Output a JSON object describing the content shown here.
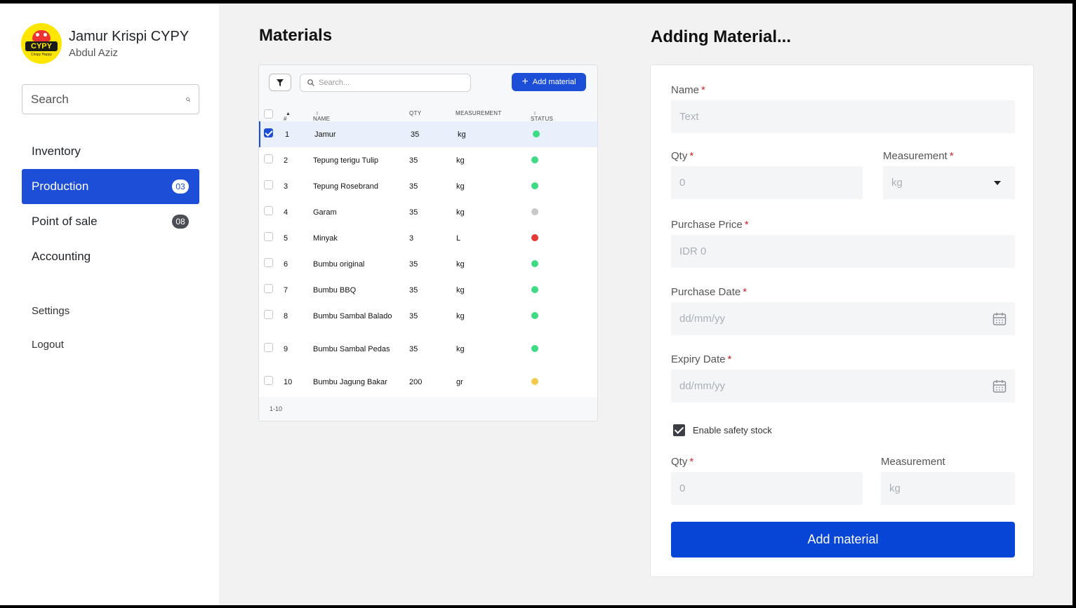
{
  "brand": {
    "logo_word": "CYPY",
    "logo_tagline": "Crispy Happy",
    "name": "Jamur Krispi CYPY",
    "user": "Abdul Aziz"
  },
  "sidebar": {
    "search_placeholder": "Search",
    "items": [
      {
        "label": "Inventory",
        "badge": ""
      },
      {
        "label": "Production",
        "badge": "03"
      },
      {
        "label": "Point of sale",
        "badge": "08"
      },
      {
        "label": "Accounting",
        "badge": ""
      }
    ],
    "settings": "Settings",
    "logout": "Logout"
  },
  "materials": {
    "title": "Materials",
    "search_placeholder": "Search...",
    "add_button": "Add material",
    "columns": {
      "num": "#",
      "name": "NAME",
      "qty": "QTY",
      "measurement": "MEASUREMENT",
      "status": "STATUS"
    },
    "rows": [
      {
        "num": "1",
        "name": "Jamur",
        "qty": "35",
        "measurement": "kg",
        "status_color": "#3ddc84",
        "checked": true
      },
      {
        "num": "2",
        "name": "Tepung terigu Tulip",
        "qty": "35",
        "measurement": "kg",
        "status_color": "#3ddc84",
        "checked": false
      },
      {
        "num": "3",
        "name": "Tepung Rosebrand",
        "qty": "35",
        "measurement": "kg",
        "status_color": "#3ddc84",
        "checked": false
      },
      {
        "num": "4",
        "name": "Garam",
        "qty": "35",
        "measurement": "kg",
        "status_color": "#c9c9c9",
        "checked": false
      },
      {
        "num": "5",
        "name": "Minyak",
        "qty": "3",
        "measurement": "L",
        "status_color": "#e53935",
        "checked": false
      },
      {
        "num": "6",
        "name": "Bumbu original",
        "qty": "35",
        "measurement": "kg",
        "status_color": "#3ddc84",
        "checked": false
      },
      {
        "num": "7",
        "name": "Bumbu BBQ",
        "qty": "35",
        "measurement": "kg",
        "status_color": "#3ddc84",
        "checked": false
      },
      {
        "num": "8",
        "name": "Bumbu Sambal Balado",
        "qty": "35",
        "measurement": "kg",
        "status_color": "#3ddc84",
        "checked": false
      },
      {
        "num": "9",
        "name": "Bumbu Sambal Pedas",
        "qty": "35",
        "measurement": "kg",
        "status_color": "#3ddc84",
        "checked": false
      },
      {
        "num": "10",
        "name": "Bumbu Jagung Bakar",
        "qty": "200",
        "measurement": "gr",
        "status_color": "#f2c94c",
        "checked": false
      }
    ],
    "pagination": "1-10"
  },
  "form": {
    "title": "Adding Material...",
    "name_label": "Name",
    "name_placeholder": "Text",
    "qty_label": "Qty",
    "qty_placeholder": "0",
    "measurement_label": "Measurement",
    "measurement_value": "kg",
    "price_label": "Purchase Price",
    "price_placeholder": "IDR 0",
    "purchase_date_label": "Purchase Date",
    "purchase_date_placeholder": "dd/mm/yy",
    "expiry_date_label": "Expiry Date",
    "expiry_date_placeholder": "dd/mm/yy",
    "safety_stock_label": "Enable safety stock",
    "safety_qty_label": "Qty",
    "safety_qty_placeholder": "0",
    "safety_measurement_label": "Measurement",
    "safety_measurement_placeholder": "kg",
    "required_mark": "*",
    "submit_label": "Add material"
  }
}
